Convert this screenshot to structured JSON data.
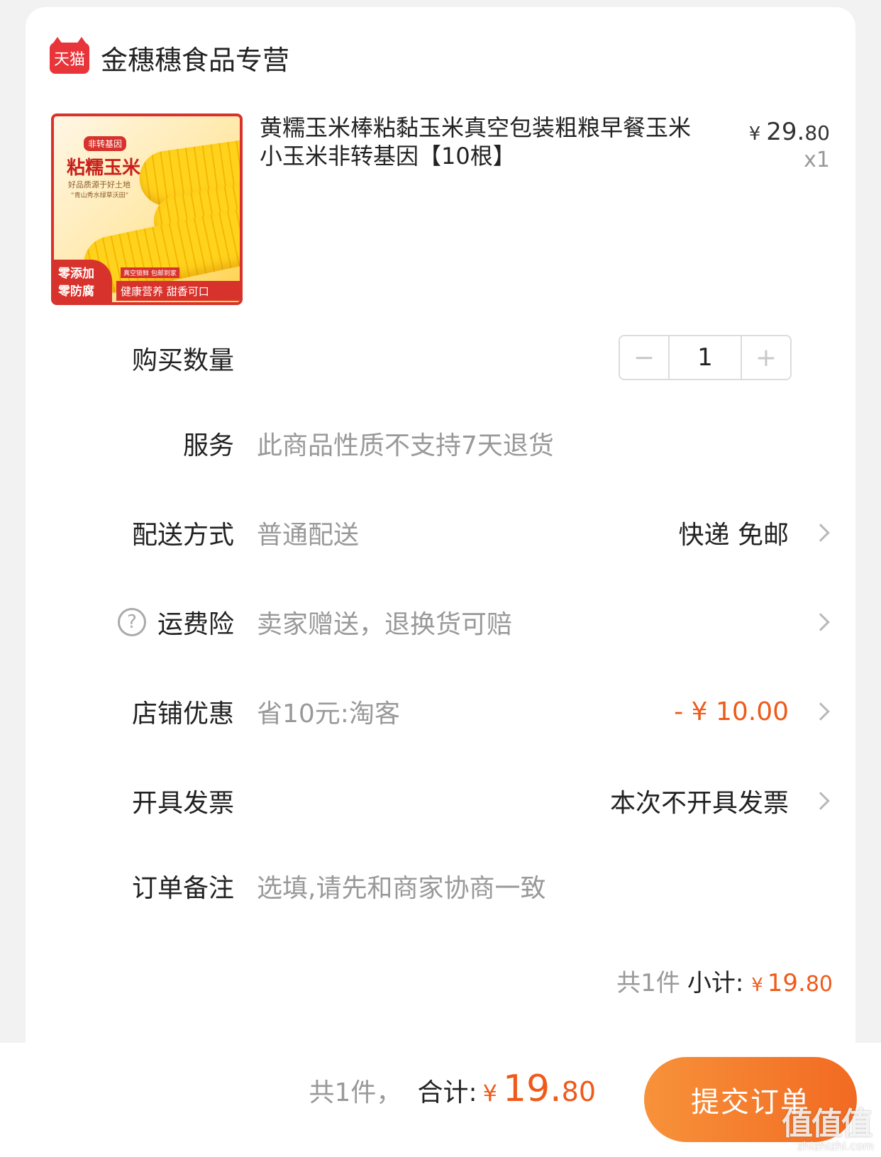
{
  "shop": {
    "badge": "天猫",
    "name": "金穗穗食品专营"
  },
  "product": {
    "image": {
      "tag": "非转基因",
      "title": "粘糯玉米",
      "subtitle": "好品质源于好土地",
      "subtitle2": "“青山秀水绿草沃田”",
      "left_band_1": "零添加",
      "left_band_2": "零防腐",
      "small_note": "真空锁鲜 包邮到家",
      "bottom_band": "健康营养 甜香可口"
    },
    "title": "黄糯玉米棒粘黏玉米真空包装粗粮早餐玉米小玉米非转基因【10根】",
    "price_symbol": "¥",
    "price_int": "29.",
    "price_dec": "80",
    "qty_label": "x1"
  },
  "quantity": {
    "label": "购买数量",
    "minus": "−",
    "value": "1",
    "plus": "+"
  },
  "service": {
    "label": "服务",
    "text": "此商品性质不支持7天退货"
  },
  "delivery": {
    "label": "配送方式",
    "text": "普通配送",
    "right": "快递 免邮"
  },
  "shipping_insurance": {
    "label": "运费险",
    "text": "卖家赠送，退换货可赔"
  },
  "store_discount": {
    "label": "店铺优惠",
    "text": "省10元:淘客",
    "right": "- ¥ 10.00"
  },
  "invoice": {
    "label": "开具发票",
    "right": "本次不开具发票"
  },
  "note": {
    "label": "订单备注",
    "placeholder": "选填,请先和商家协商一致"
  },
  "subtotal": {
    "count": "共1件",
    "label": "小计:",
    "symbol": "¥",
    "int": "19.",
    "dec": "80"
  },
  "footer": {
    "count": "共1件，",
    "label": "合计:",
    "symbol": "¥",
    "int": "19.",
    "dec": "80",
    "submit": "提交订单"
  },
  "watermark": {
    "text": "值值值",
    "sub": "zhizhizhi.com"
  },
  "colors": {
    "accent": "#ef5a1a",
    "tmall_red": "#e8353a",
    "button_start": "#f7923a",
    "button_end": "#f26a22"
  }
}
